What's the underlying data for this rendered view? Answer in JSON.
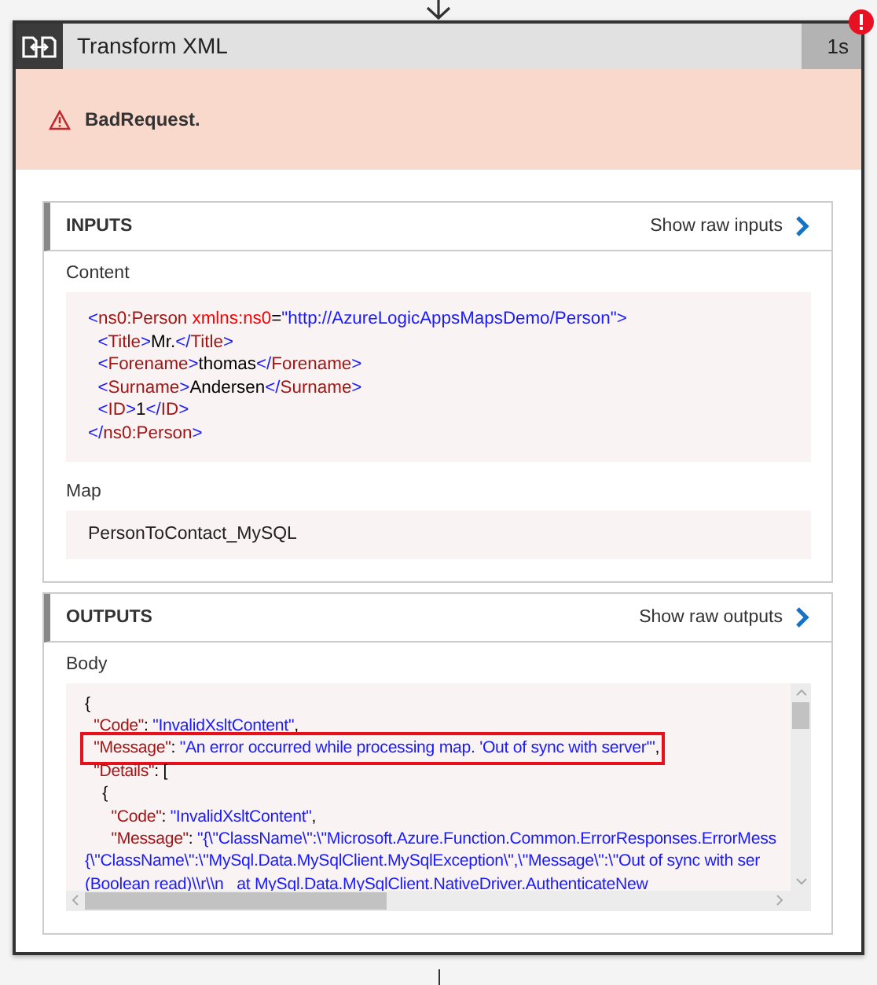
{
  "card": {
    "title": "Transform XML",
    "duration": "1s",
    "failed": true
  },
  "error": {
    "message": "BadRequest."
  },
  "sections": [
    {
      "title": "INPUTS",
      "link": "Show raw inputs",
      "fields": [
        {
          "label": "Content",
          "kind": "code",
          "lines": [
            {
              "tokens": [
                {
                  "kind": "bracket",
                  "text": "<"
                },
                {
                  "kind": "tag",
                  "text": "ns0:Person"
                },
                {
                  "kind": "attr",
                  "text": " xmlns:ns0"
                },
                {
                  "kind": "op",
                  "text": "="
                },
                {
                  "kind": "string",
                  "text": "\"http://AzureLogicAppsMapsDemo/Person\""
                },
                {
                  "kind": "bracket",
                  "text": ">"
                }
              ]
            },
            {
              "tokens": [
                {
                  "kind": "bracket",
                  "text": "  <"
                },
                {
                  "kind": "tag",
                  "text": "Title"
                },
                {
                  "kind": "bracket",
                  "text": ">"
                },
                {
                  "kind": "text",
                  "text": "Mr."
                },
                {
                  "kind": "bracket",
                  "text": "</"
                },
                {
                  "kind": "tag",
                  "text": "Title"
                },
                {
                  "kind": "bracket",
                  "text": ">"
                }
              ]
            },
            {
              "tokens": [
                {
                  "kind": "bracket",
                  "text": "  <"
                },
                {
                  "kind": "tag",
                  "text": "Forename"
                },
                {
                  "kind": "bracket",
                  "text": ">"
                },
                {
                  "kind": "text",
                  "text": "thomas"
                },
                {
                  "kind": "bracket",
                  "text": "</"
                },
                {
                  "kind": "tag",
                  "text": "Forename"
                },
                {
                  "kind": "bracket",
                  "text": ">"
                }
              ]
            },
            {
              "tokens": [
                {
                  "kind": "bracket",
                  "text": "  <"
                },
                {
                  "kind": "tag",
                  "text": "Surname"
                },
                {
                  "kind": "bracket",
                  "text": ">"
                },
                {
                  "kind": "text",
                  "text": "Andersen"
                },
                {
                  "kind": "bracket",
                  "text": "</"
                },
                {
                  "kind": "tag",
                  "text": "Surname"
                },
                {
                  "kind": "bracket",
                  "text": ">"
                }
              ]
            },
            {
              "tokens": [
                {
                  "kind": "bracket",
                  "text": "  <"
                },
                {
                  "kind": "tag",
                  "text": "ID"
                },
                {
                  "kind": "bracket",
                  "text": ">"
                },
                {
                  "kind": "text",
                  "text": "1"
                },
                {
                  "kind": "bracket",
                  "text": "</"
                },
                {
                  "kind": "tag",
                  "text": "ID"
                },
                {
                  "kind": "bracket",
                  "text": ">"
                }
              ]
            },
            {
              "tokens": [
                {
                  "kind": "bracket",
                  "text": "</"
                },
                {
                  "kind": "tag",
                  "text": "ns0:Person"
                },
                {
                  "kind": "bracket",
                  "text": ">"
                }
              ]
            }
          ]
        },
        {
          "label": "Map",
          "kind": "plain",
          "value": "PersonToContact_MySQL"
        }
      ]
    },
    {
      "title": "OUTPUTS",
      "link": "Show raw outputs",
      "fields": [
        {
          "label": "Body",
          "kind": "scroll",
          "lines": [
            {
              "highlighted": false,
              "tokens": [
                {
                  "kind": "op",
                  "text": "{"
                }
              ]
            },
            {
              "highlighted": false,
              "tokens": [
                {
                  "kind": "key",
                  "text": "  \"Code\""
                },
                {
                  "kind": "op",
                  "text": ": "
                },
                {
                  "kind": "string",
                  "text": "\"InvalidXsltContent\""
                },
                {
                  "kind": "op",
                  "text": ","
                }
              ]
            },
            {
              "highlighted": true,
              "tokens": [
                {
                  "kind": "key",
                  "text": "  \"Message\""
                },
                {
                  "kind": "op",
                  "text": ": "
                },
                {
                  "kind": "string",
                  "text": "\"An error occurred while processing map. 'Out of sync with server'\""
                },
                {
                  "kind": "op",
                  "text": ","
                }
              ]
            },
            {
              "highlighted": false,
              "tokens": [
                {
                  "kind": "key",
                  "text": "  \"Details\""
                },
                {
                  "kind": "op",
                  "text": ": ["
                }
              ]
            },
            {
              "highlighted": false,
              "tokens": [
                {
                  "kind": "op",
                  "text": "    {"
                }
              ]
            },
            {
              "highlighted": false,
              "tokens": [
                {
                  "kind": "key",
                  "text": "      \"Code\""
                },
                {
                  "kind": "op",
                  "text": ": "
                },
                {
                  "kind": "string",
                  "text": "\"InvalidXsltContent\""
                },
                {
                  "kind": "op",
                  "text": ","
                }
              ]
            },
            {
              "highlighted": false,
              "tokens": [
                {
                  "kind": "key",
                  "text": "      \"Message\""
                },
                {
                  "kind": "op",
                  "text": ": "
                },
                {
                  "kind": "string",
                  "text": "\"{\\\"ClassName\\\":\\\"Microsoft.Azure.Function.Common.ErrorResponses.ErrorMess"
                }
              ]
            },
            {
              "highlighted": false,
              "tokens": [
                {
                  "kind": "string",
                  "text": "{\\\"ClassName\\\":\\\"MySql.Data.MySqlClient.MySqlException\\\",\\\"Message\\\":\\\"Out of sync with ser"
                }
              ]
            },
            {
              "highlighted": false,
              "tokens": [
                {
                  "kind": "string",
                  "text": "(Boolean read)\\\\r\\\\n   at MySql.Data.MySqlClient.NativeDriver.AuthenticateNew"
                }
              ]
            }
          ]
        }
      ]
    }
  ]
}
